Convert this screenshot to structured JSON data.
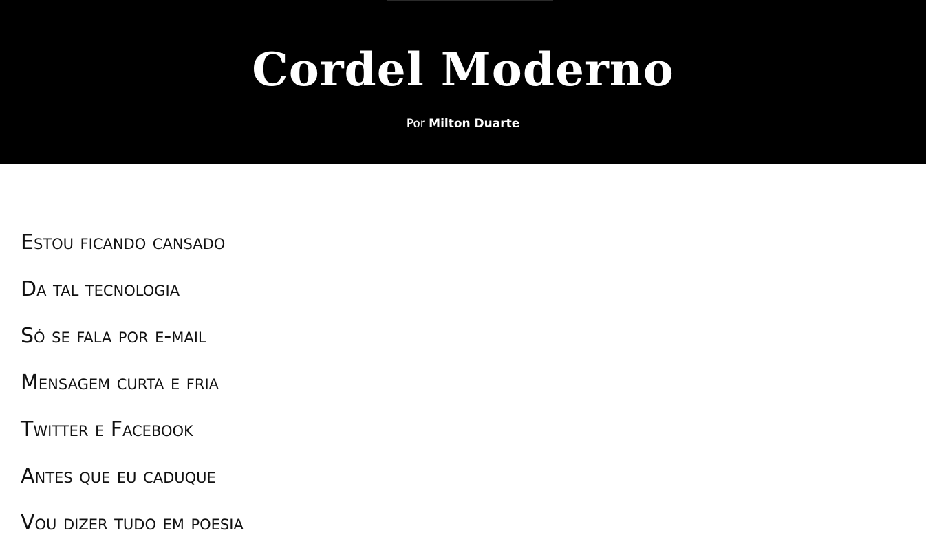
{
  "header": {
    "title": "Cordel Moderno",
    "byline_prefix": "Por",
    "author": "Milton Duarte"
  },
  "poem": {
    "verses": [
      "Estou ficando cansado",
      "Da tal tecnologia",
      "Só se fala por e-mail",
      "Mensagem curta e fria",
      "Twitter e Facebook",
      "Antes que eu caduque",
      "Vou dizer tudo em poesia"
    ]
  }
}
